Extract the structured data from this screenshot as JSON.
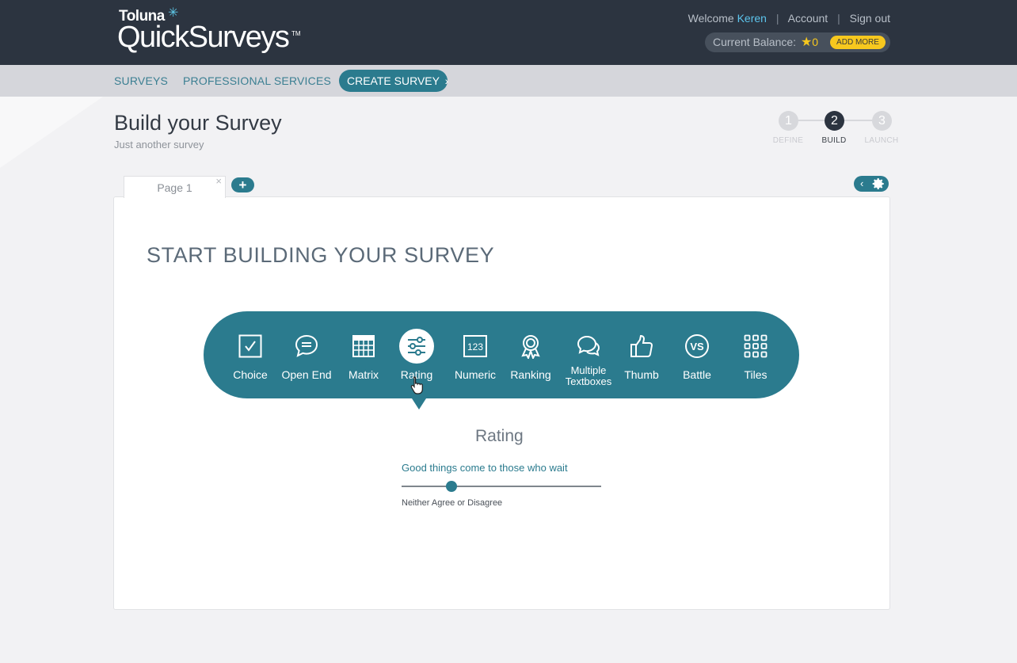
{
  "header": {
    "brand_small": "Toluna",
    "brand_big": "QuickSurveys",
    "brand_tm": "TM",
    "welcome_prefix": "Welcome",
    "user_name": "Keren",
    "account_link": "Account",
    "signout_link": "Sign out",
    "balance_label": "Current Balance:",
    "balance_amount": "0",
    "add_more": "ADD MORE",
    "accent_color": "#5cc4ec",
    "coin_color": "#f7c81e"
  },
  "nav": {
    "surveys": "SURVEYS",
    "professional_services": "PROFESSIONAL SERVICES",
    "create_survey": "CREATE SURVEY"
  },
  "page": {
    "title": "Build your Survey",
    "subtitle": "Just another survey"
  },
  "steps": [
    {
      "number": "1",
      "label": "DEFINE",
      "active": false
    },
    {
      "number": "2",
      "label": "BUILD",
      "active": true
    },
    {
      "number": "3",
      "label": "LAUNCH",
      "active": false
    }
  ],
  "tabs": {
    "page_tab": "Page 1",
    "close": "×",
    "add": "+"
  },
  "builder": {
    "heading": "START BUILDING YOUR SURVEY",
    "question_types": [
      {
        "label": "Choice",
        "icon": "checkbox-icon"
      },
      {
        "label": "Open End",
        "icon": "speech-bubble-icon"
      },
      {
        "label": "Matrix",
        "icon": "grid-icon"
      },
      {
        "label": "Rating",
        "icon": "sliders-icon",
        "selected": true
      },
      {
        "label": "Numeric",
        "icon": "numeric-123-icon"
      },
      {
        "label": "Ranking",
        "icon": "ribbon-award-icon"
      },
      {
        "label": "Multiple Textboxes",
        "icon": "chat-bubbles-icon"
      },
      {
        "label": "Thumb",
        "icon": "thumbs-up-icon"
      },
      {
        "label": "Battle",
        "icon": "vs-icon"
      },
      {
        "label": "Tiles",
        "icon": "tiles-icon"
      }
    ],
    "bar_color": "#2b7b8e"
  },
  "preview": {
    "title": "Rating",
    "question": "Good things come to those who wait",
    "slider_value": 0.25,
    "slider_label": "Neither Agree or Disagree"
  }
}
